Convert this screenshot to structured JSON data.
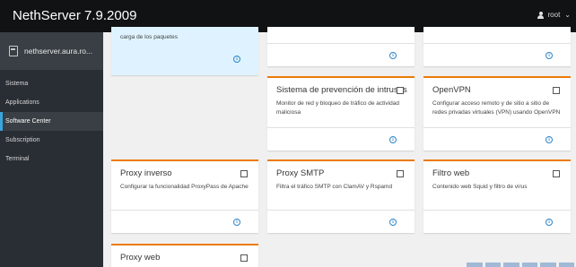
{
  "header": {
    "title": "NethServer 7.9.2009",
    "user": "root",
    "user_icon": "user-icon",
    "caret": "⌄"
  },
  "sidebar": {
    "host": "nethserver.aura.ro...",
    "host_icon": "server-icon",
    "items": [
      {
        "label": "Sistema",
        "active": false
      },
      {
        "label": "Applications",
        "active": false
      },
      {
        "label": "Software Center",
        "active": true
      },
      {
        "label": "Subscription",
        "active": false
      },
      {
        "label": "Terminal",
        "active": false
      }
    ]
  },
  "cards": [
    {
      "title": "",
      "desc": "carga de los paquetes",
      "has_check": false
    },
    {
      "title": "",
      "desc": "",
      "has_check": false
    },
    {
      "title": "",
      "desc": "",
      "has_check": false
    },
    {
      "title": "Sistema de prevención de intrusos",
      "desc": "Monitor de red y bloqueo de tráfico de actividad maliciosa",
      "has_check": true
    },
    {
      "title": "OpenVPN",
      "desc": "Configurar acceso remoto y de sitio a sitio de redes privadas virtuales (VPN) usando OpenVPN",
      "has_check": true
    },
    {
      "title": "Proxy inverso",
      "desc": "Configurar la funcionalidad ProxyPass de Apache",
      "has_check": true
    },
    {
      "title": "Proxy SMTP",
      "desc": "Filtra el tráfico SMTP con ClamAV y Rspamd",
      "has_check": true
    },
    {
      "title": "Filtro web",
      "desc": "Contenido web Squid y filtro de virus",
      "has_check": true
    },
    {
      "title": "Proxy web",
      "desc": "",
      "has_check": true
    }
  ],
  "info_glyph": "i",
  "colors": {
    "accent": "#ec7a08",
    "selected": "#39a5dc",
    "sidebar": "#292e34",
    "topbar": "#111214"
  }
}
